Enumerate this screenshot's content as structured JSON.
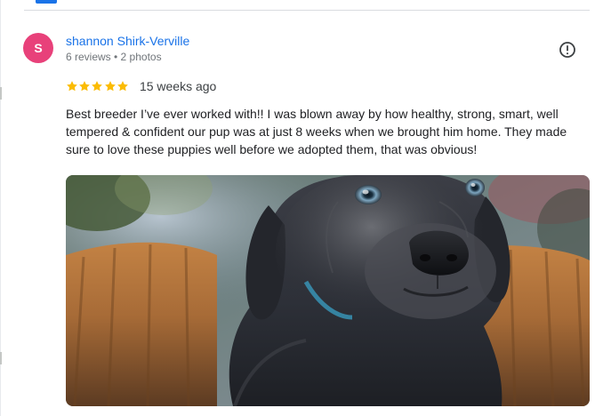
{
  "review": {
    "reviewer": {
      "initial": "S",
      "name": "shannon Shirk-Verville",
      "meta": "6 reviews • 2 photos",
      "avatar_color": "#e8417a"
    },
    "rating": 5,
    "rating_stars": "★★★★★",
    "date": "15 weeks ago",
    "text": "Best breeder I’ve ever worked with!! I was blown away by how healthy, strong, smart, well tempered & confident our pup was at just 8 weeks when we brought him home. They made sure to love these puppies well before we adopted them, that was obvious!",
    "photo": {
      "description_icon": "puppy-photo"
    },
    "report_icon": "report-icon"
  },
  "colors": {
    "link": "#1a73e8",
    "star": "#fbbc04",
    "meta": "#70757a",
    "text": "#202124"
  }
}
